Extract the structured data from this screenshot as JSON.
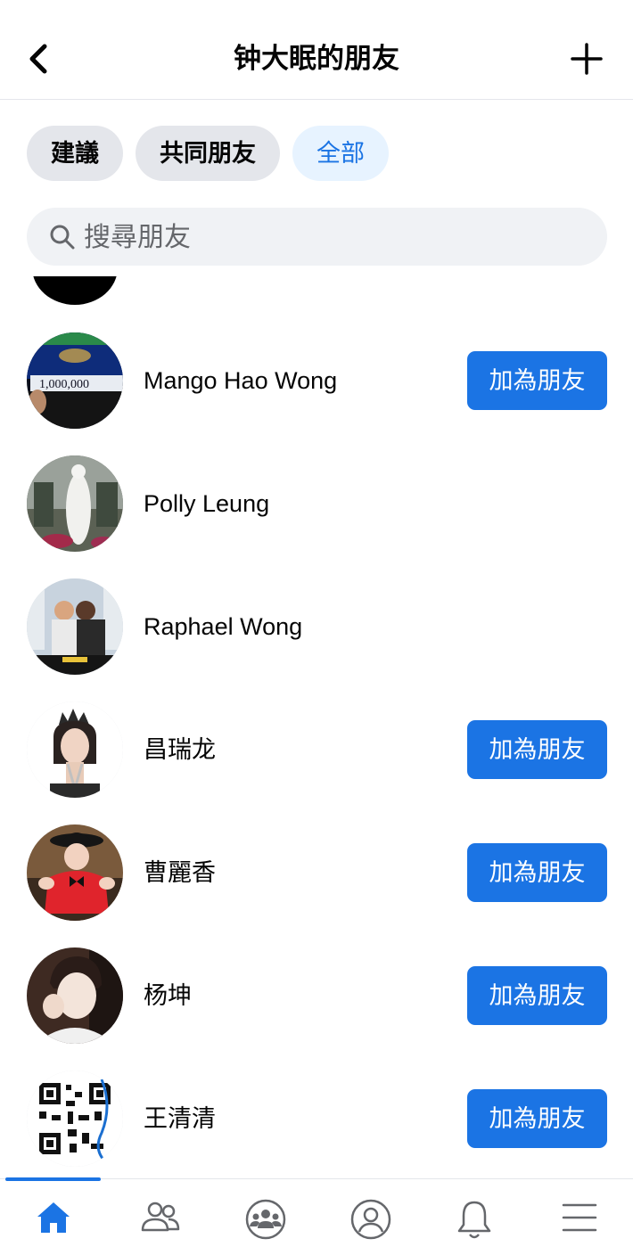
{
  "header": {
    "title": "钟大眠的朋友",
    "back_icon": "chevron-left-icon",
    "add_icon": "plus-icon"
  },
  "filters": [
    {
      "label": "建議",
      "active": false
    },
    {
      "label": "共同朋友",
      "active": false
    },
    {
      "label": "全部",
      "active": true
    }
  ],
  "search": {
    "placeholder": "搜尋朋友",
    "icon": "search-icon"
  },
  "friends": [
    {
      "name": "Mango Hao Wong",
      "button": "加為朋友"
    },
    {
      "name": "Polly Leung",
      "button": ""
    },
    {
      "name": "Raphael Wong",
      "button": ""
    },
    {
      "name": "昌瑞龙",
      "button": "加為朋友"
    },
    {
      "name": "曹麗香",
      "button": "加為朋友"
    },
    {
      "name": "杨坤",
      "button": "加為朋友"
    },
    {
      "name": "王清清",
      "button": "加為朋友"
    }
  ],
  "tabbar": {
    "active": "home",
    "icons": [
      "home-icon",
      "friends-icon",
      "groups-icon",
      "profile-icon",
      "notifications-icon",
      "menu-icon"
    ]
  },
  "colors": {
    "accent": "#1b74e4",
    "chip_bg": "#e4e6eb",
    "chip_active_bg": "#e7f3ff",
    "search_bg": "#f0f2f5"
  }
}
